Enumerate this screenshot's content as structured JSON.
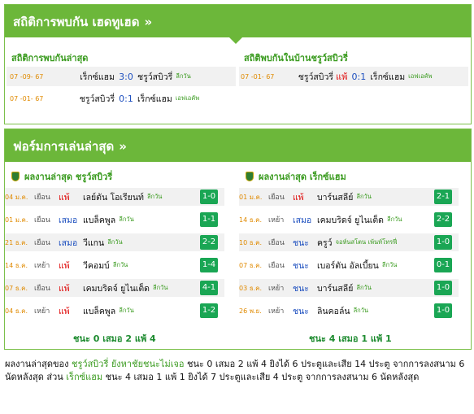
{
  "h2h_header": {
    "title": "สถิติการพบกัน เฮดทูเฮด",
    "chevron": "»"
  },
  "h2h_recent": {
    "title": "สถิติการพบกันล่าสุด",
    "rows": [
      {
        "date": "07 -09- 67",
        "home": "เร็กซ์แฮม",
        "score": "3:0",
        "away": "ชรูว์สบิวรี่",
        "league": "ลีกวัน"
      },
      {
        "date": "07 -01- 67",
        "home": "ชรูว์สบิวรี่",
        "score": "0:1",
        "away": "เร็กซ์แฮม",
        "league": "เอฟเอคัพ"
      }
    ]
  },
  "h2h_home": {
    "title": "สถิติพบกันในบ้านชรูว์สบิวรี่",
    "rows": [
      {
        "date": "07 -01- 67",
        "home": "ชรูว์สบิวรี่",
        "result": "แพ้",
        "score": "0:1",
        "away": "เร็กซ์แฮม",
        "league": "เอฟเอคัพ"
      }
    ]
  },
  "form_header": {
    "title": "ฟอร์มการเล่นล่าสุด",
    "chevron": "»"
  },
  "form_left": {
    "title": "ผลงานล่าสุด ชรูว์สบิวรี่",
    "rows": [
      {
        "date": "04 ม.ค.",
        "venue": "เยือน",
        "result": "แพ้",
        "type": "lose",
        "opponent": "เลย์ตัน โอเรียนท์",
        "league": "ลีกวัน",
        "score": "1-0"
      },
      {
        "date": "01 ม.ค.",
        "venue": "เยือน",
        "result": "เสมอ",
        "type": "draw",
        "opponent": "แบล็คพูล",
        "league": "ลีกวัน",
        "score": "1-1"
      },
      {
        "date": "21 ธ.ค.",
        "venue": "เยือน",
        "result": "เสมอ",
        "type": "draw",
        "opponent": "วีแกน",
        "league": "ลีกวัน",
        "score": "2-2"
      },
      {
        "date": "14 ธ.ค.",
        "venue": "เหย้า",
        "result": "แพ้",
        "type": "lose",
        "opponent": "วีคอมบ์",
        "league": "ลีกวัน",
        "score": "1-4"
      },
      {
        "date": "07 ธ.ค.",
        "venue": "เยือน",
        "result": "แพ้",
        "type": "lose",
        "opponent": "เคมบริดจ์ ยูไนเต็ด",
        "league": "ลีกวัน",
        "score": "4-1"
      },
      {
        "date": "04 ธ.ค.",
        "venue": "เหย้า",
        "result": "แพ้",
        "type": "lose",
        "opponent": "แบล็คพูล",
        "league": "ลีกวัน",
        "score": "1-2"
      }
    ],
    "summary": "ชนะ 0 เสมอ 2 แพ้ 4"
  },
  "form_right": {
    "title": "ผลงานล่าสุด เร็กซ์แฮม",
    "rows": [
      {
        "date": "01 ม.ค.",
        "venue": "เยือน",
        "result": "แพ้",
        "type": "lose",
        "opponent": "บาร์นสลีย์",
        "league": "ลีกวัน",
        "score": "2-1"
      },
      {
        "date": "14 ธ.ค.",
        "venue": "เหย้า",
        "result": "เสมอ",
        "type": "draw",
        "opponent": "เคมบริดจ์ ยูไนเต็ด",
        "league": "ลีกวัน",
        "score": "2-2"
      },
      {
        "date": "10 ธ.ค.",
        "venue": "เยือน",
        "result": "ชนะ",
        "type": "win",
        "opponent": "ครูว์",
        "league": "จอห์นสโตน เพ้นท์โทรฟี่",
        "score": "1-0"
      },
      {
        "date": "07 ธ.ค.",
        "venue": "เยือน",
        "result": "ชนะ",
        "type": "win",
        "opponent": "เบอร์ตัน อัลเบี้ยน",
        "league": "ลีกวัน",
        "score": "0-1"
      },
      {
        "date": "03 ธ.ค.",
        "venue": "เหย้า",
        "result": "ชนะ",
        "type": "win",
        "opponent": "บาร์นสลีย์",
        "league": "ลีกวัน",
        "score": "1-0"
      },
      {
        "date": "26 พ.ย.",
        "venue": "เหย้า",
        "result": "ชนะ",
        "type": "win",
        "opponent": "ลินคอล์น",
        "league": "ลีกวัน",
        "score": "1-0"
      }
    ],
    "summary": "ชนะ 4 เสมอ 1 แพ้ 1"
  },
  "bottom": {
    "p1": "ผลงานล่าสุดของ ",
    "t1": "ชรูว์สบิวรี่ ยังหาชัยชนะไม่เจอ",
    "p2": " ชนะ 0 เสมอ 2 แพ้ 4 ยิงได้ 6 ประตูและเสีย 14 ประตู จากการลงสนาม 6 นัดหลังสุด ส่วน ",
    "t2": "เร็กซ์แฮม",
    "p3": " ชนะ 4 เสมอ 1 แพ้ 1 ยิงได้ 7 ประตูและเสีย 4 ประตู จากการลงสนาม 6 นัดหลังสุด"
  }
}
